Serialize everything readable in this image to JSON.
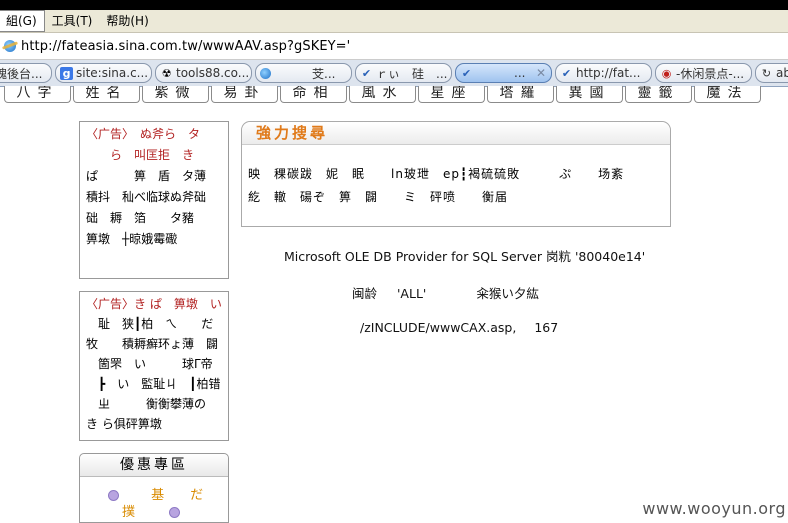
{
  "menu": {
    "items": [
      {
        "label": "組(G)",
        "active": true
      },
      {
        "label": "工具(T)",
        "active": false
      },
      {
        "label": "帮助(H)",
        "active": false
      }
    ]
  },
  "address": {
    "icon": "ie-page-icon",
    "url": "http://fateasia.sina.com.tw/wwwAAV.asp?gSKEY='"
  },
  "tabs": [
    {
      "label": "塊後台...",
      "icon": "",
      "active": false
    },
    {
      "label": "site:sina.c...",
      "icon": "google-icon",
      "active": false
    },
    {
      "label": "tools88.co...",
      "icon": "radiation-icon",
      "active": false
    },
    {
      "label": "芠...",
      "icon": "ie-icon",
      "active": false
    },
    {
      "label": "ｒぃ　硅　...",
      "icon": "check-icon",
      "active": false
    },
    {
      "label": "...",
      "icon": "check-icon",
      "active": true,
      "close": "✕"
    },
    {
      "label": "http://fat...",
      "icon": "check-icon",
      "active": false
    },
    {
      "label": "-休闲景点-...",
      "icon": "sina-icon",
      "active": false
    },
    {
      "label": "ab",
      "icon": "refresh-icon",
      "active": false
    }
  ],
  "nav": {
    "items": [
      "八字",
      "姓名",
      "紫微",
      "易卦",
      "命相",
      "風水",
      "星座",
      "塔羅",
      "異國",
      "靈籤",
      "魔法"
    ]
  },
  "ad1": {
    "lines": [
      "〈广告〉　ぬ斧ら　タ",
      "　　ら　叫匡拒　き",
      "ぱ　　　箅　盾　タ薄",
      "積抖　秈べ临球ぬ斧础",
      "础　耨　箔　　タ豬",
      "箅墩　┼晾娥霉礮"
    ]
  },
  "ad2": {
    "lines": [
      "〈广告〉き ぱ　箅墩　い",
      "　耻　狭┃柏　ㄟ　　だ",
      "牧　　積耨癬环ょ薄　闢",
      "　箇罘　い　　　球Γ帝",
      "　┣　い　監耻ㄐ　┃柏错",
      "　ㄓ　　　衡衡攀薄の",
      "き ら俱砰箅墩"
    ]
  },
  "promo": {
    "title": "優惠專區",
    "row1": "基　　だ",
    "row2": "撲"
  },
  "search": {
    "title": "強力搜尋",
    "line1": "映　稞碳跋　妮　眠　　ln玻玴　ep┇褐硫硫敗　　　ぷ　　场紊",
    "line2": "紇　轍　碭ぞ　箅　闢　　ミ　砰喷　　衡届"
  },
  "error": {
    "provider": "Microsoft OLE DB Provider for SQL Server  岗粇  '80040e14'",
    "detail_prefix": "闽龄",
    "detail_value": "'ALL'",
    "detail_suffix": "籴猴い夕紘",
    "file": "/zINCLUDE/wwwCAX.asp,",
    "line_no": "167"
  },
  "watermark": "www.wooyun.org"
}
